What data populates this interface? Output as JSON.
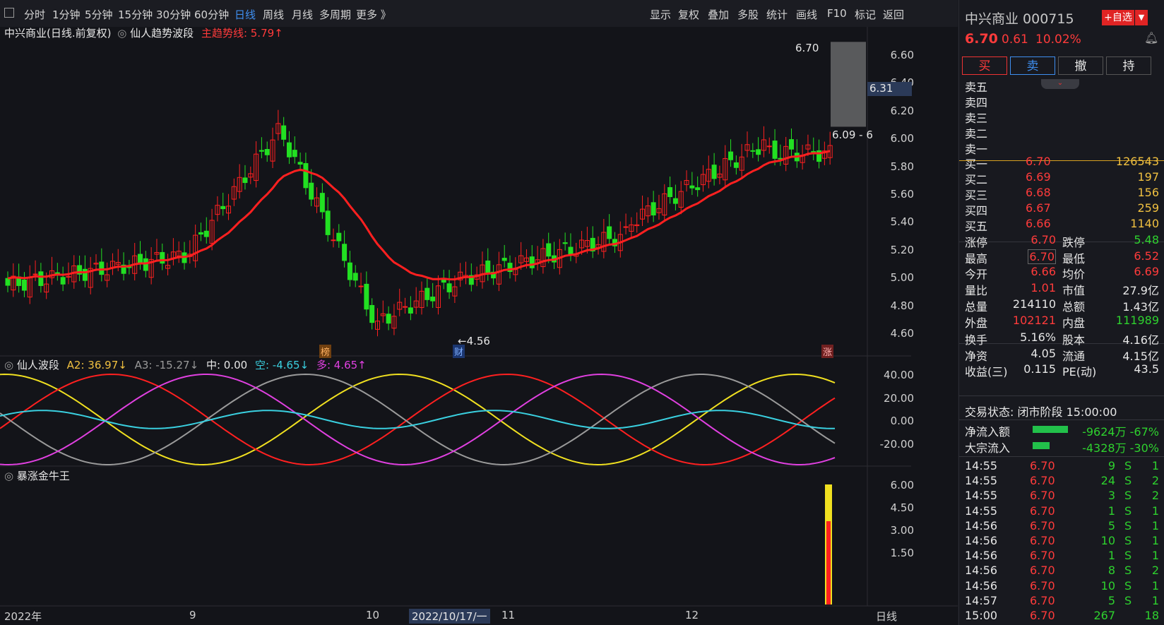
{
  "toolbar": {
    "periods": [
      "分时",
      "1分钟",
      "5分钟",
      "15分钟",
      "30分钟",
      "60分钟",
      "日线",
      "周线",
      "月线",
      "多周期",
      "更多 》"
    ],
    "active_period": "日线",
    "right_items": [
      "显示",
      "复权",
      "叠加",
      "多股",
      "统计",
      "画线",
      "F10",
      "标记",
      "返回"
    ]
  },
  "main_chart": {
    "title": "中兴商业(日线.前复权)",
    "indicator_name": "仙人趋势波段",
    "trend_line_label": "主趋势线: 5.79↑",
    "y_ticks": [
      "6.60",
      "6.40",
      "6.20",
      "6.00",
      "5.80",
      "5.60",
      "5.40",
      "5.20",
      "5.00",
      "4.80",
      "4.60"
    ],
    "price_tag": "6.31",
    "high_label": "6.70",
    "low_label": "←4.56",
    "range_label": "6.09 - 6",
    "markers": [
      "榜",
      "财",
      "涨"
    ]
  },
  "osc_panel": {
    "name": "仙人波段",
    "a2": "A2: 36.97↓",
    "a3": "A3: -15.27↓",
    "mid": "中: 0.00",
    "kong": "空: -4.65↓",
    "duo": "多: 4.65↑",
    "y_ticks": [
      "40.00",
      "20.00",
      "0.00",
      "-20.00"
    ]
  },
  "vol_panel": {
    "name": "暴涨金牛王",
    "y_ticks": [
      "6.00",
      "4.50",
      "3.00",
      "1.50"
    ]
  },
  "x_axis": {
    "labels": [
      "2022年",
      "9",
      "10",
      "2022/10/17/一",
      "11",
      "12",
      "日线"
    ]
  },
  "quote": {
    "name_code": "中兴商业 000715",
    "add_watch": "+自选",
    "price": "6.70",
    "change": "0.61",
    "change_pct": "10.02%",
    "trade_buttons": [
      "买",
      "卖",
      "撤",
      "持"
    ],
    "asks": [
      "卖五",
      "卖四",
      "卖三",
      "卖二",
      "卖一"
    ],
    "bids": [
      {
        "label": "买一",
        "price": "6.70",
        "vol": "126543"
      },
      {
        "label": "买二",
        "price": "6.69",
        "vol": "197"
      },
      {
        "label": "买三",
        "price": "6.68",
        "vol": "156"
      },
      {
        "label": "买四",
        "price": "6.67",
        "vol": "259"
      },
      {
        "label": "买五",
        "price": "6.66",
        "vol": "1140"
      }
    ],
    "stats": [
      {
        "k1": "涨停",
        "v1": "6.70",
        "k2": "跌停",
        "v2": "5.48"
      },
      {
        "k1": "最高",
        "v1": "6.70",
        "k2": "最低",
        "v2": "6.52"
      },
      {
        "k1": "今开",
        "v1": "6.66",
        "k2": "均价",
        "v2": "6.69"
      },
      {
        "k1": "量比",
        "v1": "1.01",
        "k2": "市值",
        "v2": "27.9亿"
      },
      {
        "k1": "总量",
        "v1": "214110",
        "k2": "总额",
        "v2": "1.43亿"
      },
      {
        "k1": "外盘",
        "v1": "102121",
        "k2": "内盘",
        "v2": "111989"
      }
    ],
    "fund": [
      {
        "k1": "换手",
        "v1": "5.16%",
        "k2": "股本",
        "v2": "4.16亿"
      },
      {
        "k1": "净资",
        "v1": "4.05",
        "k2": "流通",
        "v2": "4.15亿"
      },
      {
        "k1": "收益(三)",
        "v1": "0.115",
        "k2": "PE(动)",
        "v2": "43.5"
      }
    ],
    "status": "交易状态: 闭市阶段 15:00:00",
    "flows": [
      {
        "label": "净流入额",
        "value": "-9624万 -67%"
      },
      {
        "label": "大宗流入",
        "value": "-4328万 -30%"
      }
    ],
    "ticks": [
      {
        "t": "14:55",
        "p": "6.70",
        "v": "9",
        "s": "S",
        "n": "1"
      },
      {
        "t": "14:55",
        "p": "6.70",
        "v": "24",
        "s": "S",
        "n": "2"
      },
      {
        "t": "14:55",
        "p": "6.70",
        "v": "3",
        "s": "S",
        "n": "2"
      },
      {
        "t": "14:55",
        "p": "6.70",
        "v": "1",
        "s": "S",
        "n": "1"
      },
      {
        "t": "14:56",
        "p": "6.70",
        "v": "5",
        "s": "S",
        "n": "1"
      },
      {
        "t": "14:56",
        "p": "6.70",
        "v": "10",
        "s": "S",
        "n": "1"
      },
      {
        "t": "14:56",
        "p": "6.70",
        "v": "1",
        "s": "S",
        "n": "1"
      },
      {
        "t": "14:56",
        "p": "6.70",
        "v": "8",
        "s": "S",
        "n": "2"
      },
      {
        "t": "14:56",
        "p": "6.70",
        "v": "10",
        "s": "S",
        "n": "1"
      },
      {
        "t": "14:57",
        "p": "6.70",
        "v": "5",
        "s": "S",
        "n": "1"
      },
      {
        "t": "15:00",
        "p": "6.70",
        "v": "267",
        "s": "",
        "n": "18"
      }
    ]
  },
  "colors": {
    "up": "#ff2020",
    "down": "#22e022",
    "accent": "#3f8ff0"
  }
}
